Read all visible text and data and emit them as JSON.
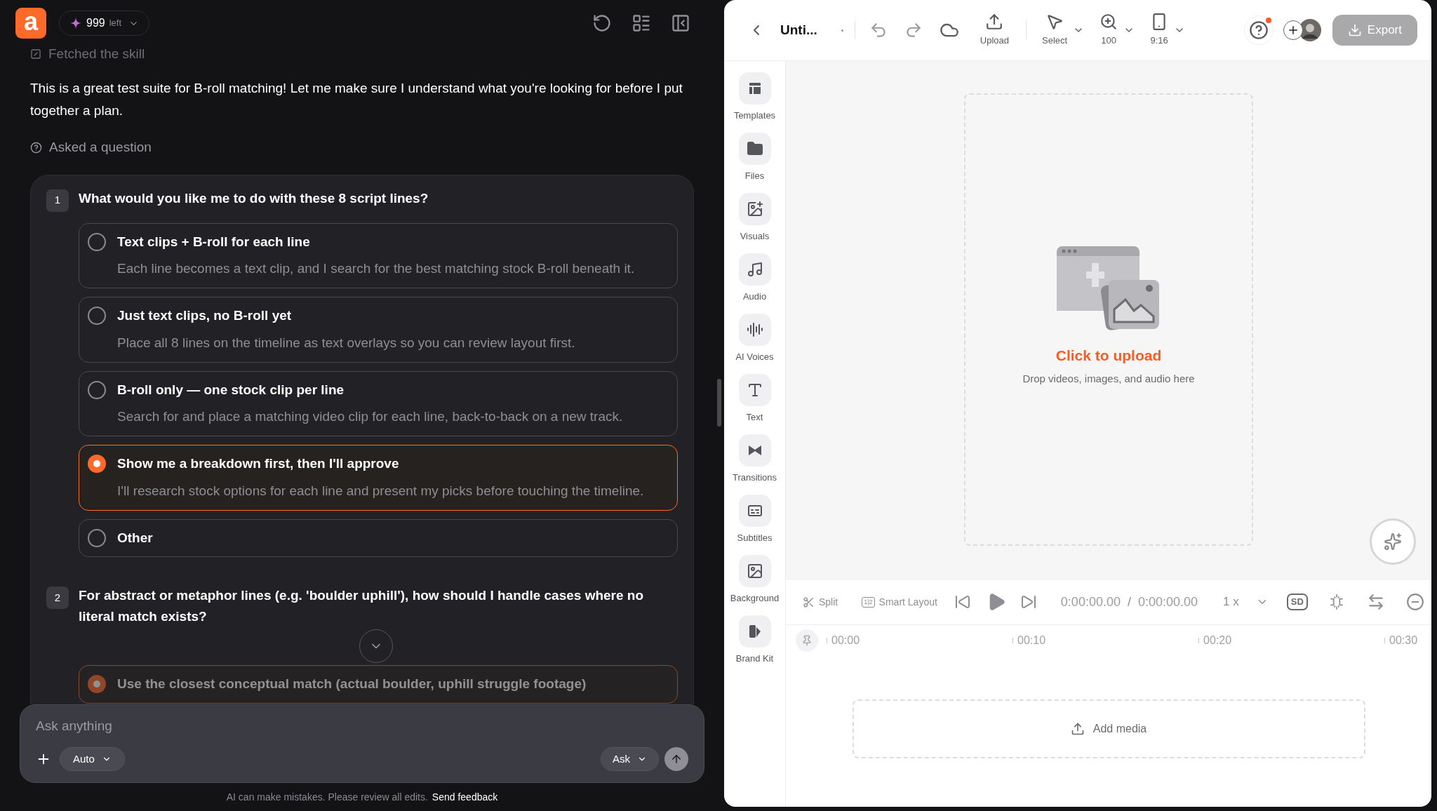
{
  "chat_header": {
    "logo_letter": "a",
    "credits_count": "999",
    "credits_label": "left"
  },
  "activity": [
    {
      "kind": "skill",
      "text": "Fetched the skill"
    },
    {
      "kind": "message",
      "text": "This is a great test suite for B-roll matching! Let me make sure I understand what you're looking for before I put together a plan."
    },
    {
      "kind": "question",
      "text": "Asked a question"
    }
  ],
  "questions": [
    {
      "number": "1",
      "text": "What would you like me to do with these 8 script lines?",
      "options": [
        {
          "title": "Text clips + B-roll for each line",
          "description": "Each line becomes a text clip, and I search for the best matching stock B-roll beneath it.",
          "selected": false
        },
        {
          "title": "Just text clips, no B-roll yet",
          "description": "Place all 8 lines on the timeline as text overlays so you can review layout first.",
          "selected": false
        },
        {
          "title": "B-roll only — one stock clip per line",
          "description": "Search for and place a matching video clip for each line, back-to-back on a new track.",
          "selected": false
        },
        {
          "title": "Show me a breakdown first, then I'll approve",
          "description": "I'll research stock options for each line and present my picks before touching the timeline.",
          "selected": true
        },
        {
          "title": "Other",
          "selected": false
        }
      ]
    },
    {
      "number": "2",
      "text": "For abstract or metaphor lines (e.g. 'boulder uphill'), how should I handle cases where no literal match exists?",
      "options": [
        {
          "title": "Use the closest conceptual match (actual boulder, uphill struggle footage)",
          "selected": true
        }
      ]
    }
  ],
  "composer": {
    "placeholder": "Ask anything",
    "mode": "Auto",
    "action": "Ask"
  },
  "footer": {
    "notice": "AI can make mistakes. Please review all edits.",
    "link": "Send feedback"
  },
  "editor_toolbar": {
    "title": "Unti...",
    "tools": [
      {
        "kind": "upload",
        "label": "Upload"
      },
      {
        "kind": "select",
        "label": "Select"
      },
      {
        "kind": "zoom",
        "label": "100"
      },
      {
        "kind": "ratio",
        "label": "9:16"
      }
    ],
    "help_notification": true,
    "export": {
      "label": "Export",
      "disabled": true
    }
  },
  "sidebar": {
    "items": [
      {
        "kind": "templates",
        "label": "Templates"
      },
      {
        "kind": "files",
        "label": "Files"
      },
      {
        "kind": "visuals",
        "label": "Visuals"
      },
      {
        "kind": "audio",
        "label": "Audio"
      },
      {
        "kind": "voices",
        "label": "AI Voices"
      },
      {
        "kind": "text",
        "label": "Text"
      },
      {
        "kind": "transitions",
        "label": "Transitions"
      },
      {
        "kind": "subtitles",
        "label": "Subtitles"
      },
      {
        "kind": "background",
        "label": "Background"
      },
      {
        "kind": "brand",
        "label": "Brand Kit"
      }
    ]
  },
  "canvas": {
    "upload_title": "Click to upload",
    "upload_hint": "Drop videos, images, and audio here"
  },
  "playback": {
    "split": "Split",
    "smart_layout": "Smart Layout",
    "smart_layout_icon": "1|2",
    "current_time": "0:00:00.00",
    "separator": "/",
    "total_time": "0:00:00.00",
    "speed": "1 x",
    "quality": "SD"
  },
  "ruler": {
    "ticks": [
      "00:00",
      "00:10",
      "00:20",
      "00:30"
    ]
  },
  "track": {
    "add_media": "Add media"
  }
}
